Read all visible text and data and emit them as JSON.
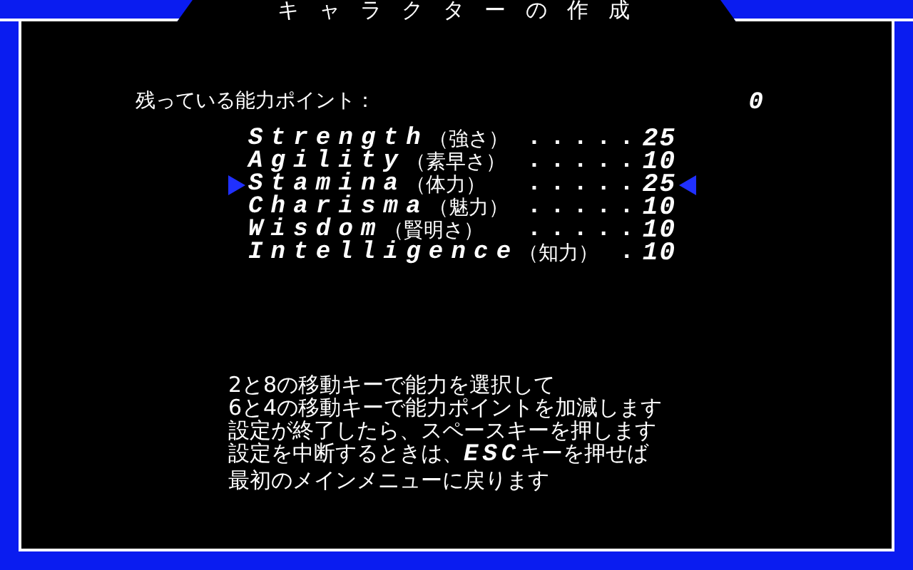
{
  "window": {
    "title": "キャラクターの作成"
  },
  "points": {
    "label": "残っている能力ポイント：",
    "value": "0"
  },
  "stats": [
    {
      "name": "Strength",
      "jp": "（強さ）",
      "dots": ".....",
      "value": "25",
      "selected": false
    },
    {
      "name": "Agility",
      "jp": "（素早さ）",
      "dots": ".....",
      "value": "10",
      "selected": false
    },
    {
      "name": "Stamina",
      "jp": "（体力）",
      "dots": ".....",
      "value": "25",
      "selected": true
    },
    {
      "name": "Charisma",
      "jp": "（魅力）",
      "dots": ".....",
      "value": "10",
      "selected": false
    },
    {
      "name": "Wisdom",
      "jp": "（賢明さ）",
      "dots": ".....",
      "value": "10",
      "selected": false
    },
    {
      "name": "Intelligence",
      "jp": "（知力）",
      "dots": ".",
      "value": "10",
      "selected": false
    }
  ],
  "instructions": [
    "2と8の移動キーで能力を選択して",
    "6と4の移動キーで能力ポイントを加減します",
    "設定が終了したら、スペースキーを押します",
    "設定を中断するときは、**ESC**キーを押せば",
    "最初のメインメニューに戻ります"
  ]
}
